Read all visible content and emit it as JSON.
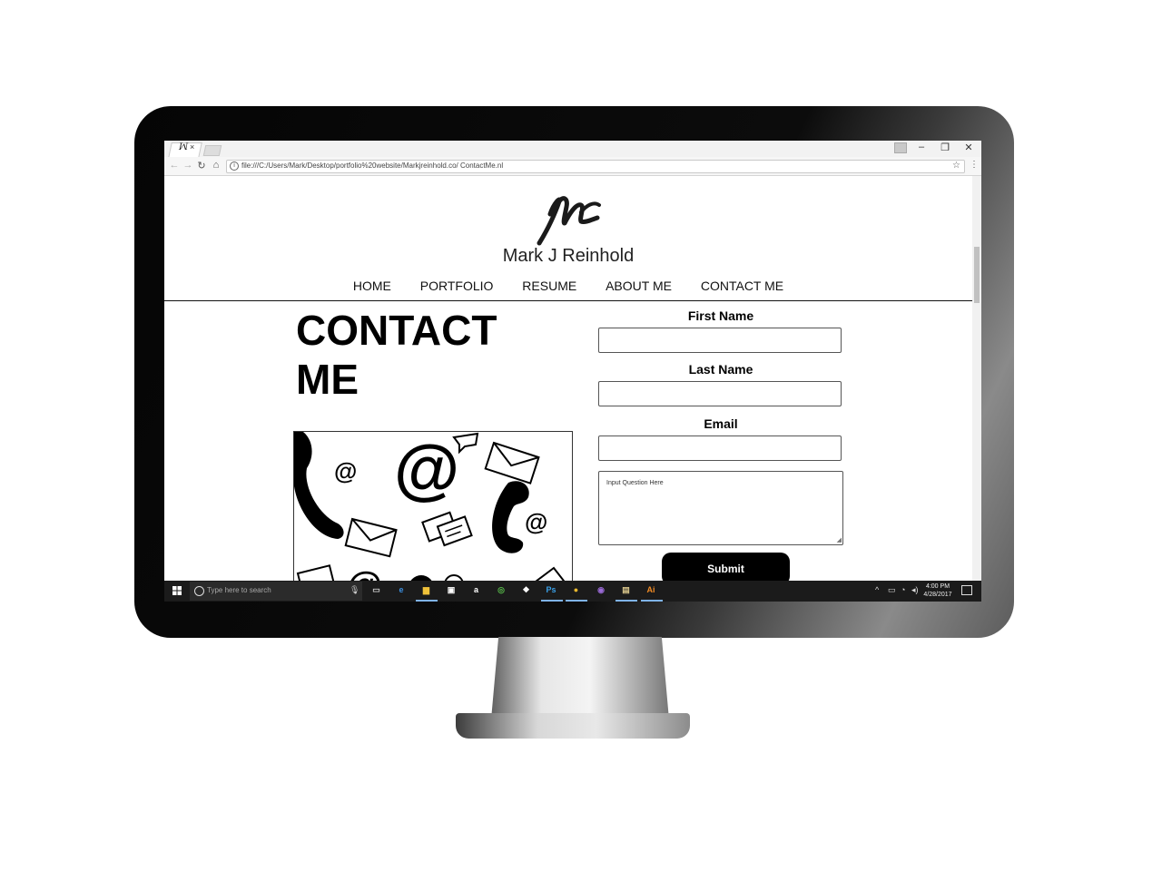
{
  "browser": {
    "tab_close": "×",
    "address_url": "file:///C:/Users/Mark/Desktop/portfolio%20website/Markjreinhold.co/ ContactMe.nl",
    "window_minimize": "–",
    "window_restore": "❐",
    "window_close": "✕",
    "back_icon": "←",
    "forward_icon": "→",
    "reload_icon": "↻",
    "home_icon": "⌂",
    "star_icon": "☆",
    "menu_icon": "⋮",
    "info_icon": "i"
  },
  "site": {
    "name": "Mark J Reinhold",
    "nav": [
      "HOME",
      "PORTFOLIO",
      "RESUME",
      "ABOUT ME",
      "CONTACT ME"
    ],
    "heading": "CONTACT ME"
  },
  "form": {
    "first_name_label": "First Name",
    "last_name_label": "Last Name",
    "email_label": "Email",
    "question_placeholder": "Input Question Here",
    "submit_label": "Submit"
  },
  "taskbar": {
    "search_placeholder": "Type here to search",
    "apps": [
      {
        "name": "task-view",
        "glyph": "▭",
        "color": "#cccccc"
      },
      {
        "name": "edge",
        "glyph": "e",
        "color": "#3b8fe0"
      },
      {
        "name": "file-explorer",
        "glyph": "▆",
        "color": "#f0c23a"
      },
      {
        "name": "store",
        "glyph": "▣",
        "color": "#ffffff"
      },
      {
        "name": "amazon",
        "glyph": "a",
        "color": "#ffffff"
      },
      {
        "name": "tripadvisor",
        "glyph": "◎",
        "color": "#57b94a"
      },
      {
        "name": "dropbox",
        "glyph": "❖",
        "color": "#ffffff"
      },
      {
        "name": "photoshop",
        "glyph": "Ps",
        "color": "#3aa0e8"
      },
      {
        "name": "chrome",
        "glyph": "●",
        "color": "#e8b82e"
      },
      {
        "name": "app-circle",
        "glyph": "◉",
        "color": "#9a6ad6"
      },
      {
        "name": "app-window",
        "glyph": "▤",
        "color": "#d7c48a"
      },
      {
        "name": "illustrator",
        "glyph": "Ai",
        "color": "#f08a24"
      }
    ],
    "tray_chevron": "^",
    "time": "4:00 PM",
    "date": "4/28/2017"
  }
}
